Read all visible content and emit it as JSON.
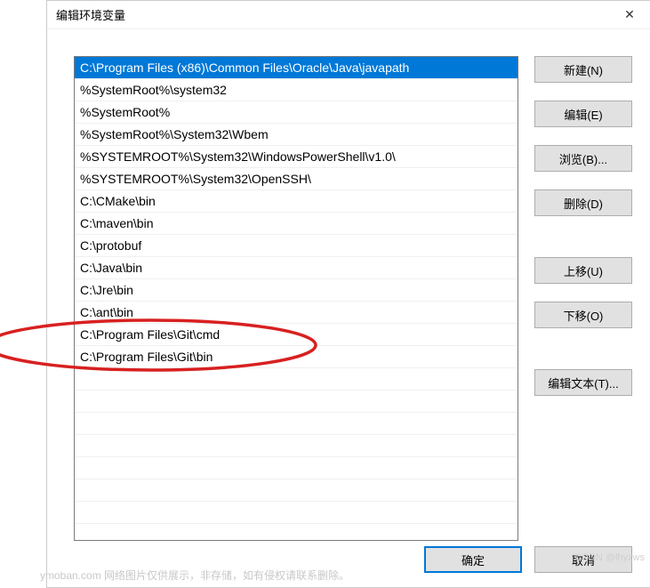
{
  "dialog": {
    "title": "编辑环境变量",
    "close_icon": "✕"
  },
  "list": {
    "items": [
      "C:\\Program Files (x86)\\Common Files\\Oracle\\Java\\javapath",
      "%SystemRoot%\\system32",
      "%SystemRoot%",
      "%SystemRoot%\\System32\\Wbem",
      "%SYSTEMROOT%\\System32\\WindowsPowerShell\\v1.0\\",
      "%SYSTEMROOT%\\System32\\OpenSSH\\",
      "C:\\CMake\\bin",
      "C:\\maven\\bin",
      "C:\\protobuf",
      "C:\\Java\\bin",
      "C:\\Jre\\bin",
      "C:\\ant\\bin",
      "C:\\Program Files\\Git\\cmd",
      "C:\\Program Files\\Git\\bin"
    ],
    "selected_index": 0
  },
  "buttons": {
    "new": "新建(N)",
    "edit": "编辑(E)",
    "browse": "浏览(B)...",
    "delete": "删除(D)",
    "move_up": "上移(U)",
    "move_down": "下移(O)",
    "edit_text": "编辑文本(T)...",
    "ok": "确定",
    "cancel": "取消"
  },
  "watermarks": {
    "left": "ymoban.com 网络图片仅供展示，非存储，如有侵权请联系删除。",
    "right": "CSDN @lhyzws"
  }
}
